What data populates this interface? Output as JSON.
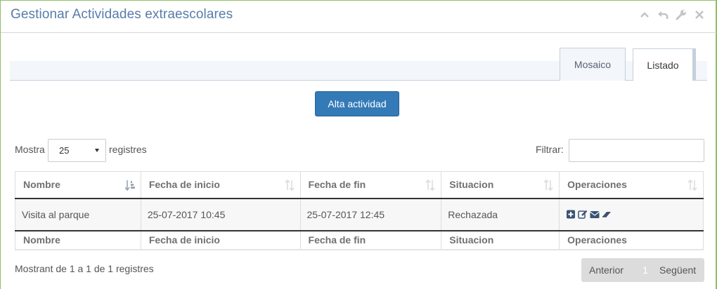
{
  "header": {
    "title": "Gestionar Actividades extraescolares",
    "tools": [
      "chevron-up-icon",
      "undo-icon",
      "wrench-icon",
      "close-icon"
    ]
  },
  "tabs": [
    {
      "label": "Mosaico",
      "active": false
    },
    {
      "label": "Listado",
      "active": true
    }
  ],
  "actions": {
    "alta_label": "Alta actividad"
  },
  "length": {
    "prefix": "Mostra",
    "value": "25",
    "suffix": "registres"
  },
  "filter": {
    "label": "Filtrar:",
    "value": ""
  },
  "table": {
    "columns": [
      "Nombre",
      "Fecha de inicio",
      "Fecha de fin",
      "Situacion",
      "Operaciones"
    ],
    "rows": [
      {
        "nombre": "Visita al parque",
        "inicio": "25-07-2017 10:45",
        "fin": "25-07-2017 12:45",
        "situacion": "Rechazada",
        "operations": [
          "plus-square-icon",
          "edit-icon",
          "envelope-icon",
          "eraser-icon"
        ]
      }
    ]
  },
  "info": "Mostrant de 1 a 1 de 1 registres",
  "pagination": {
    "prev": "Anterior",
    "current": "1",
    "next": "Següent"
  },
  "colors": {
    "title": "#587cab",
    "button": "#337ab7",
    "border_green": "#8fbf6a",
    "icon": "#3a5373"
  }
}
